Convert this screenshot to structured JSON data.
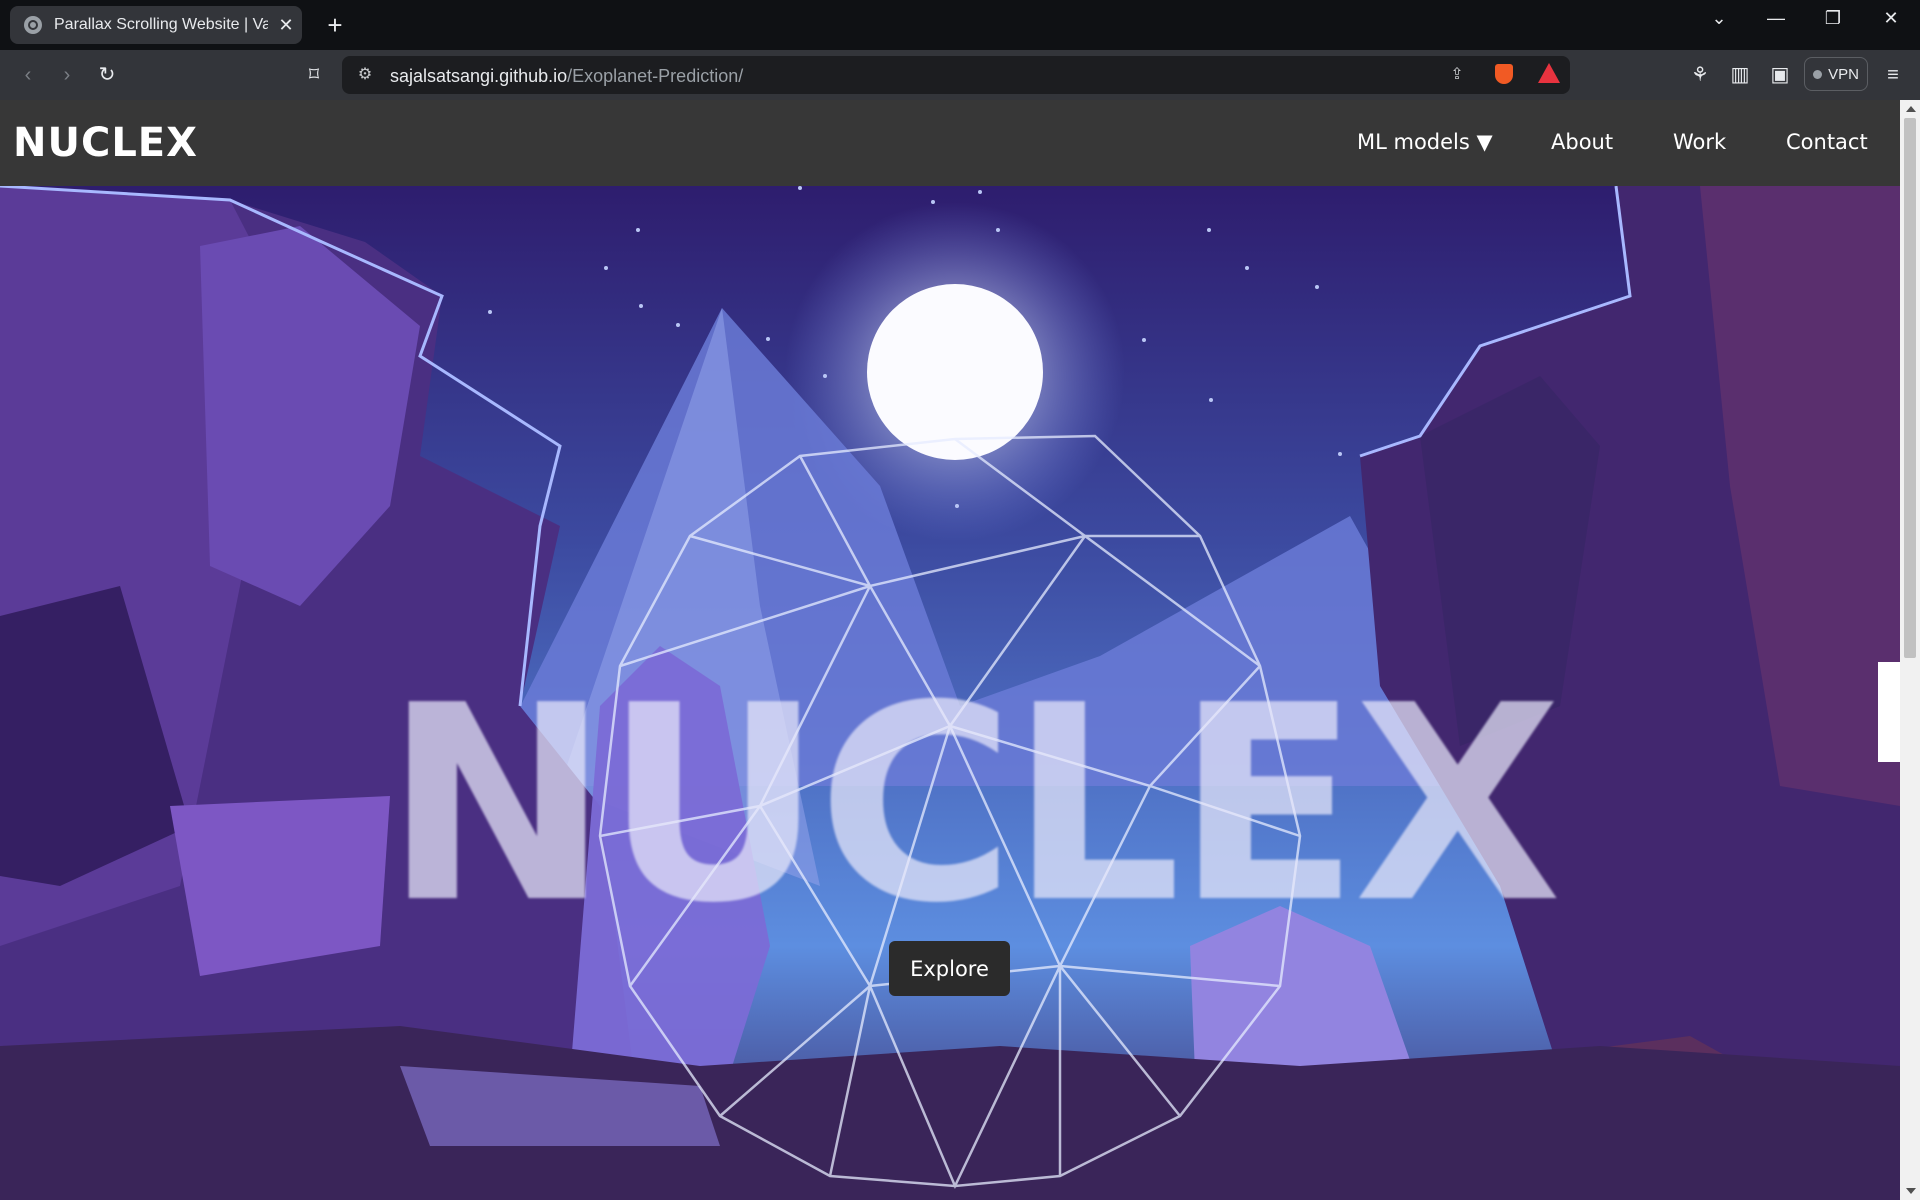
{
  "browser": {
    "tab_title": "Parallax Scrolling Website | Vanil",
    "url_host": "sajalsatsangi.github.io",
    "url_path": "/Exoplanet-Prediction/",
    "vpn_label": "VPN"
  },
  "site": {
    "logo": "NUCLEX",
    "nav": [
      "ML models ▼",
      "About",
      "Work",
      "Contact"
    ],
    "hero_title": "NUCLEX",
    "explore_label": "Explore"
  }
}
